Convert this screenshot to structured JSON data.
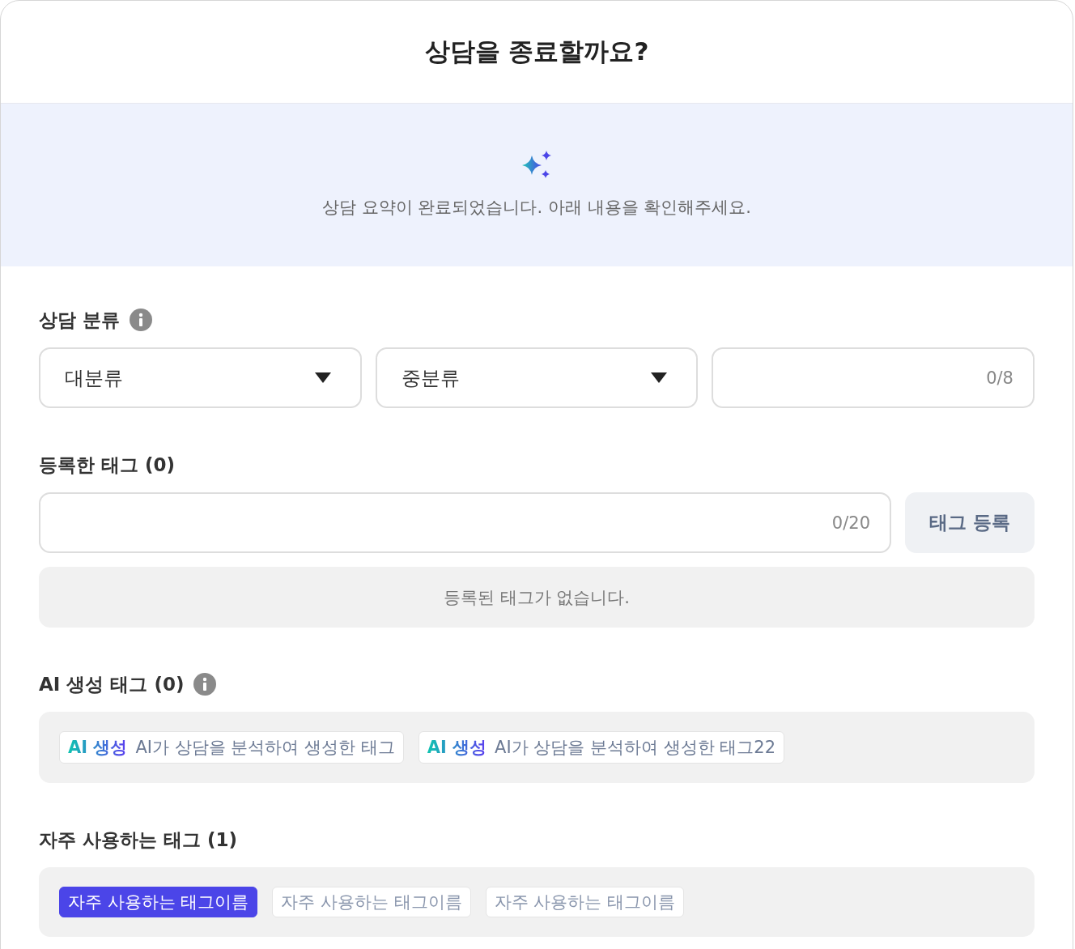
{
  "dialog": {
    "title": "상담을 종료할까요?"
  },
  "summary_banner": {
    "message": "상담 요약이 완료되었습니다. 아래 내용을 확인해주세요."
  },
  "classification": {
    "label": "상담 분류",
    "dropdowns": [
      {
        "placeholder": "대분류"
      },
      {
        "placeholder": "중분류"
      }
    ],
    "input": {
      "counter": "0/8"
    }
  },
  "registered_tags": {
    "label": "등록한 태그 (0)",
    "input": {
      "counter": "0/20"
    },
    "button": "태그 등록",
    "empty_message": "등록된 태그가 없습니다."
  },
  "ai_tags": {
    "label": "AI 생성 태그 (0)",
    "tags": [
      {
        "badge": "AI 생성",
        "text": "AI가 상담을 분석하여 생성한 태그"
      },
      {
        "badge": "AI 생성",
        "text": "AI가 상담을 분석하여 생성한 태그22"
      }
    ]
  },
  "frequent_tags": {
    "label": "자주 사용하는 태그 (1)",
    "tags": [
      {
        "text": "자주 사용하는 태그이름",
        "selected": true
      },
      {
        "text": "자주 사용하는 태그이름",
        "selected": false
      },
      {
        "text": "자주 사용하는 태그이름",
        "selected": false
      }
    ]
  }
}
